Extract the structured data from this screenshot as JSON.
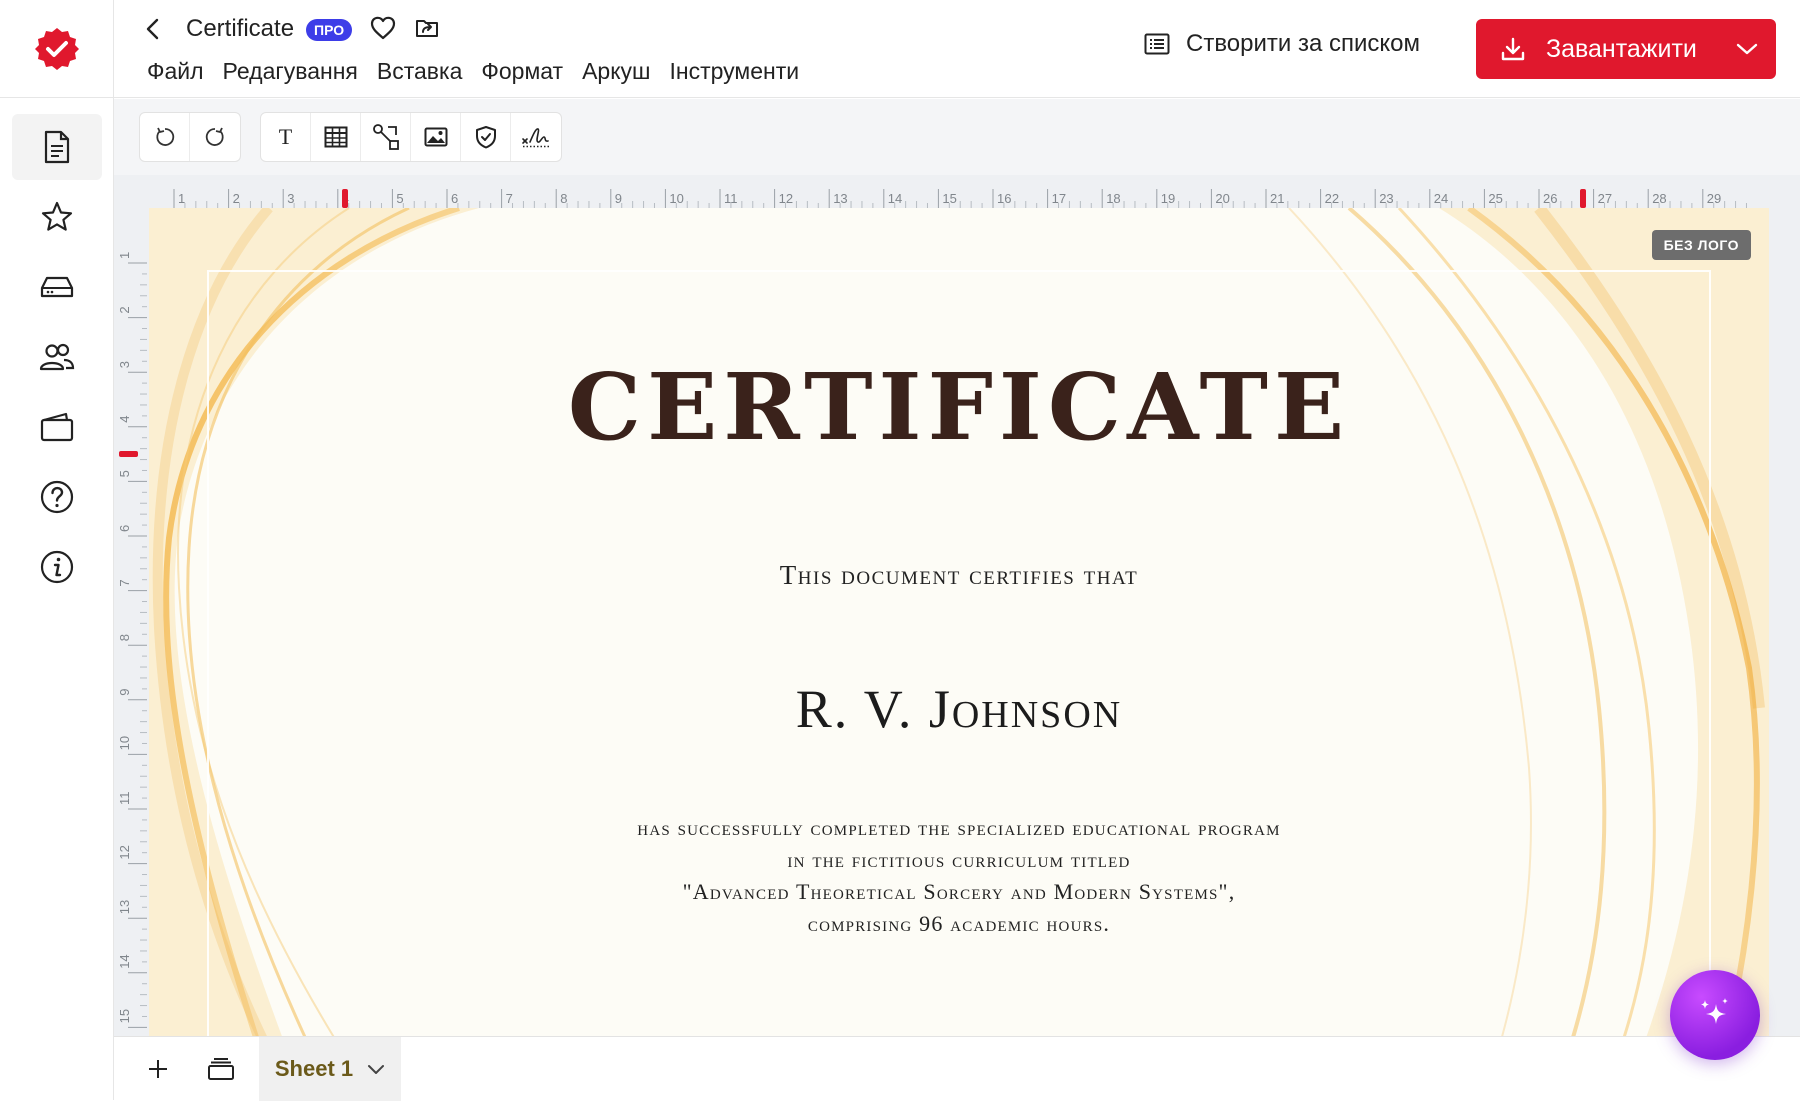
{
  "header": {
    "title": "Certificate",
    "pro_badge": "ПРО",
    "menu": [
      "Файл",
      "Редагування",
      "Вставка",
      "Формат",
      "Аркуш",
      "Інструменти"
    ],
    "create_by_list": "Створити за списком",
    "download": "Завантажити"
  },
  "certificate": {
    "badge": "БЕЗ ЛОГО",
    "title": "CERTIFICATE",
    "subtitle": "This document certifies that",
    "name": "R. V. Johnson",
    "body": [
      "has successfully completed the specialized educational program",
      "in the fictitious curriculum titled",
      "\"Advanced Theoretical Sorcery and Modern Systems\",",
      "comprising 96 academic hours."
    ]
  },
  "ruler": {
    "top_labels": [
      "1",
      "2",
      "3",
      "4",
      "5",
      "6",
      "7",
      "8",
      "9",
      "10",
      "11",
      "12",
      "13",
      "14",
      "15",
      "16",
      "17",
      "18",
      "19",
      "20",
      "21",
      "22",
      "23",
      "24",
      "25",
      "26",
      "27",
      "28",
      "29"
    ],
    "left_labels": [
      "1",
      "2",
      "3",
      "4",
      "5",
      "6",
      "7",
      "8",
      "9",
      "10",
      "11",
      "12",
      "13",
      "14",
      "15"
    ]
  },
  "footer": {
    "sheet_tab": "Sheet 1"
  },
  "colors": {
    "brand": "#e0182d",
    "pro": "#3d3de8",
    "title_text": "#3a221b",
    "gold": "#f1b64a"
  }
}
